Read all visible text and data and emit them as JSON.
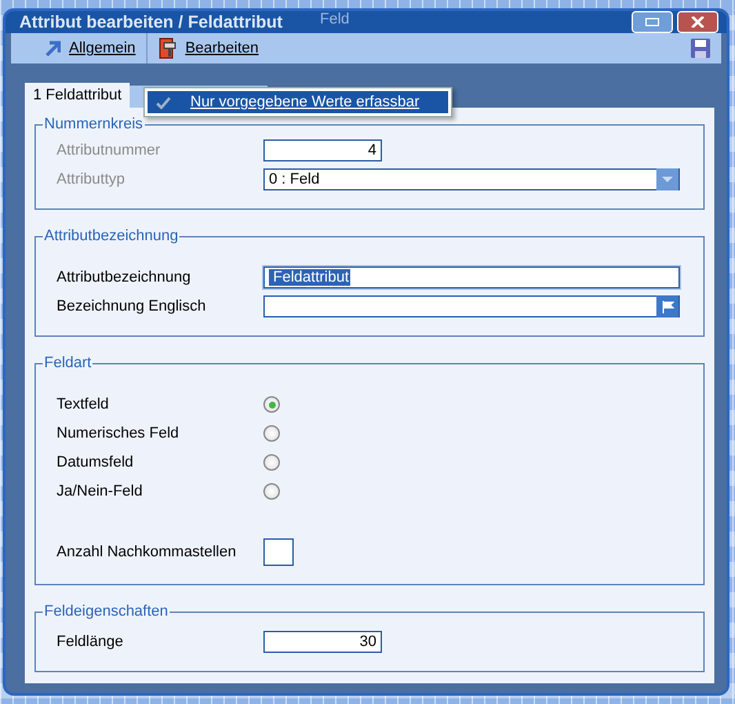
{
  "background": {
    "column_header": "Feld"
  },
  "window": {
    "title": "Attribut bearbeiten / Feldattribut"
  },
  "toolbar": {
    "items": [
      {
        "label": "Allgemein",
        "kind": "arrow"
      },
      {
        "label": "Bearbeiten",
        "kind": "edit"
      }
    ]
  },
  "menu": {
    "items": [
      {
        "label": "Nur vorgegebene Werte erfassbar",
        "checked": true
      }
    ]
  },
  "tabs": [
    {
      "label": "1 Feldattribut",
      "selected": true
    },
    {
      "selected": false
    }
  ],
  "groups": [
    {
      "title": "Nummernkreis",
      "rows": [
        {
          "kind": "number",
          "label": "Attributnummer",
          "value": "4",
          "disabled": true
        },
        {
          "kind": "dropdown",
          "label": "Attributtyp",
          "value": "0 : Feld",
          "disabled": true
        }
      ]
    },
    {
      "title": "Attributbezeichnung",
      "rows": [
        {
          "kind": "text",
          "label": "Attributbezeichnung",
          "value": "Feldattribut",
          "focused": true
        },
        {
          "kind": "translate",
          "label": "Bezeichnung Englisch"
        }
      ]
    },
    {
      "title": "Feldart",
      "rows": [
        {
          "kind": "radio",
          "label": "Textfeld",
          "selected": true
        },
        {
          "kind": "radio",
          "label": "Numerisches Feld",
          "selected": false
        },
        {
          "kind": "radio",
          "label": "Datumsfeld",
          "selected": false
        },
        {
          "kind": "radio",
          "label": "Ja/Nein-Feld",
          "selected": false
        },
        {
          "kind": "small",
          "label": "Anzahl Nachkommastellen"
        }
      ]
    },
    {
      "title": "Feldeigenschaften",
      "rows": [
        {
          "kind": "number",
          "label": "Feldlänge",
          "value": "30"
        }
      ]
    }
  ]
}
